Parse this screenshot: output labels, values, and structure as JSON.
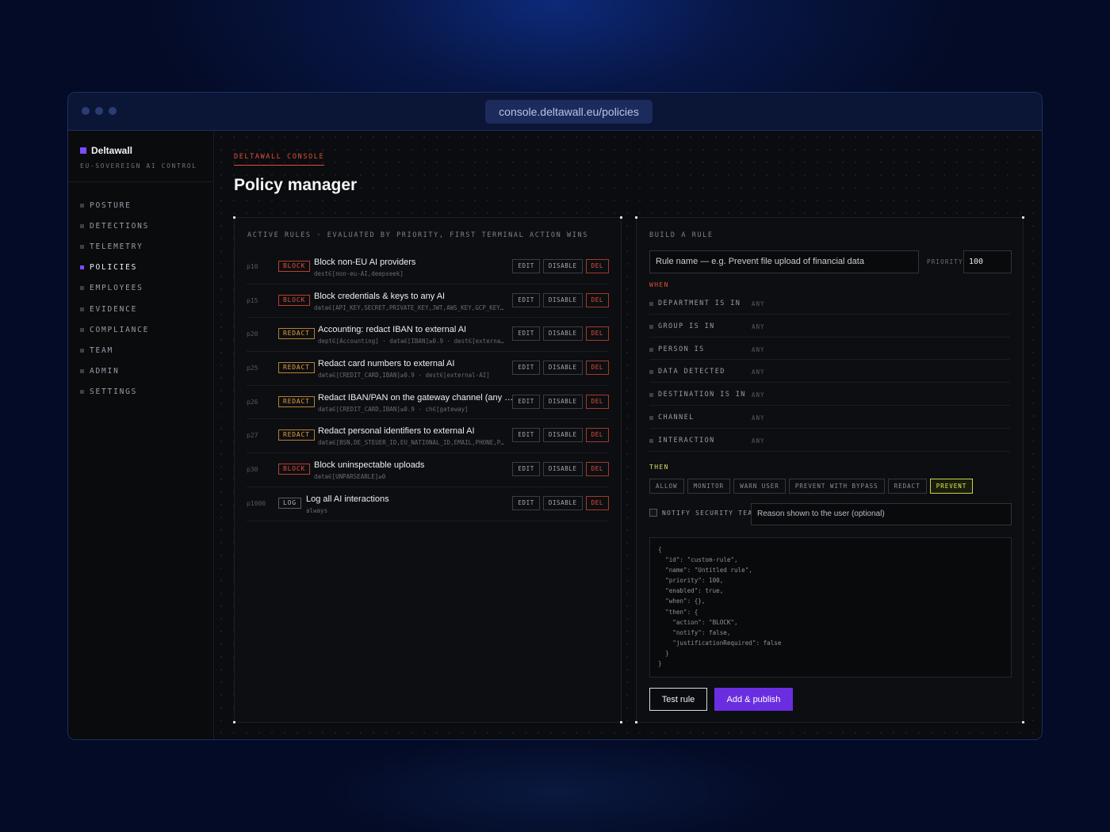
{
  "browser": {
    "url": "console.deltawall.eu/policies"
  },
  "sidebar": {
    "brand": "Deltawall",
    "tagline": "EU-SOVEREIGN AI CONTROL",
    "items": [
      {
        "label": "POSTURE",
        "active": false
      },
      {
        "label": "DETECTIONS",
        "active": false
      },
      {
        "label": "TELEMETRY",
        "active": false
      },
      {
        "label": "POLICIES",
        "active": true
      },
      {
        "label": "EMPLOYEES",
        "active": false
      },
      {
        "label": "EVIDENCE",
        "active": false
      },
      {
        "label": "COMPLIANCE",
        "active": false
      },
      {
        "label": "TEAM",
        "active": false
      },
      {
        "label": "ADMIN",
        "active": false
      },
      {
        "label": "SETTINGS",
        "active": false
      }
    ]
  },
  "header": {
    "eyebrow": "DELTAWALL CONSOLE",
    "title": "Policy manager"
  },
  "rules_panel": {
    "heading": "ACTIVE RULES · EVALUATED BY PRIORITY, FIRST TERMINAL ACTION WINS",
    "action_labels": {
      "edit": "EDIT",
      "disable": "DISABLE",
      "del": "DEL"
    },
    "rules": [
      {
        "priority": "p10",
        "action": "BLOCK",
        "title": "Block non-EU AI providers",
        "condition": "dest∈[non-eu-AI,deepseek]"
      },
      {
        "priority": "p15",
        "action": "BLOCK",
        "title": "Block credentials & keys to any AI",
        "condition": "data∈[API_KEY,SECRET,PRIVATE_KEY,JWT,AWS_KEY,GCP_KEY…"
      },
      {
        "priority": "p20",
        "action": "REDACT",
        "title": "Accounting: redact IBAN to external AI",
        "condition": "dept∈[Accounting] · data∈[IBAN]≥0.9 · dest∈[externa…"
      },
      {
        "priority": "p25",
        "action": "REDACT",
        "title": "Redact card numbers to external AI",
        "condition": "data∈[CREDIT_CARD,IBAN]≥0.9 · dest∈[external-AI]"
      },
      {
        "priority": "p26",
        "action": "REDACT",
        "title": "Redact IBAN/PAN on the gateway channel (any provider)",
        "condition": "data∈[CREDIT_CARD,IBAN]≥0.9 · ch∈[gateway]"
      },
      {
        "priority": "p27",
        "action": "REDACT",
        "title": "Redact personal identifiers to external AI",
        "condition": "data∈[BSN,DE_STEUER_ID,EU_NATIONAL_ID,EMAIL,PHONE,P…"
      },
      {
        "priority": "p30",
        "action": "BLOCK",
        "title": "Block uninspectable uploads",
        "condition": "data∈[UNPARSEABLE]≥0"
      },
      {
        "priority": "p1000",
        "action": "LOG",
        "title": "Log all AI interactions",
        "condition": "always"
      }
    ]
  },
  "builder": {
    "heading": "BUILD A RULE",
    "name_placeholder": "Rule name — e.g. Prevent file upload of financial data",
    "priority_label": "PRIORITY",
    "priority_value": "100",
    "when_label": "WHEN",
    "conditions": [
      {
        "label": "DEPARTMENT IS IN",
        "value": "ANY"
      },
      {
        "label": "GROUP IS IN",
        "value": "ANY"
      },
      {
        "label": "PERSON IS",
        "value": "ANY"
      },
      {
        "label": "DATA DETECTED",
        "value": "ANY"
      },
      {
        "label": "DESTINATION IS IN",
        "value": "ANY"
      },
      {
        "label": "CHANNEL",
        "value": "ANY"
      },
      {
        "label": "INTERACTION",
        "value": "ANY"
      }
    ],
    "then_label": "THEN",
    "then_options": [
      "ALLOW",
      "MONITOR",
      "WARN USER",
      "PREVENT WITH BYPASS",
      "REDACT",
      "PREVENT"
    ],
    "then_selected": "PREVENT",
    "notify_label": "NOTIFY SECURITY TEAM",
    "reason_placeholder": "Reason shown to the user (optional)",
    "json_preview": "{\n  \"id\": \"custom-rule\",\n  \"name\": \"Untitled rule\",\n  \"priority\": 100,\n  \"enabled\": true,\n  \"when\": {},\n  \"then\": {\n    \"action\": \"BLOCK\",\n    \"notify\": false,\n    \"justificationRequired\": false\n  }\n}",
    "test_label": "Test rule",
    "publish_label": "Add & publish"
  },
  "colors": {
    "accent": "#6a2ee0",
    "brand": "#7b4dff",
    "block": "#e0503a",
    "redact": "#e0a040",
    "prevent": "#e2ec5a"
  }
}
